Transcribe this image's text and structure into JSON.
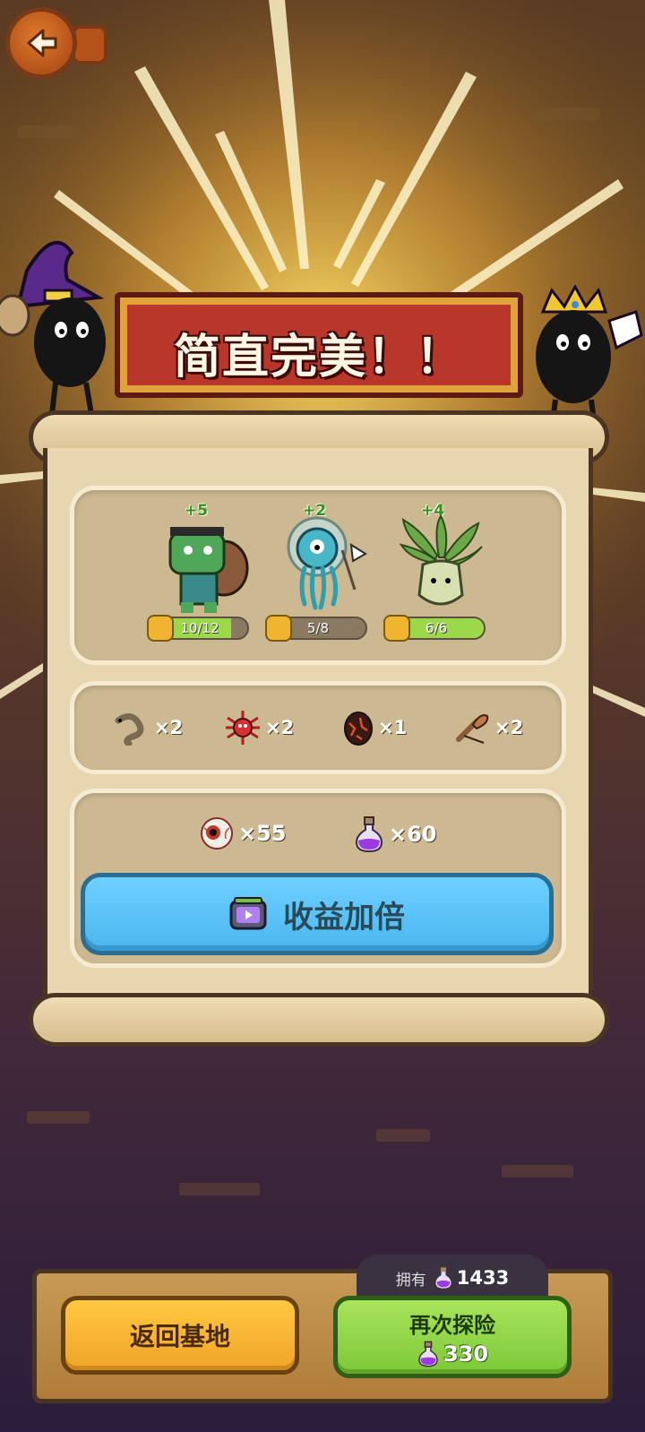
{
  "banner": {
    "title": "简直完美！！"
  },
  "monsters": [
    {
      "name": "frankenstein",
      "plus": "+5",
      "progress_text": "10/12",
      "progress": 0.83
    },
    {
      "name": "jellyfish-diver",
      "plus": "+2",
      "progress_text": "5/8",
      "progress": 0.0
    },
    {
      "name": "herb-plant",
      "plus": "+4",
      "progress_text": "6/6",
      "progress": 1.0
    }
  ],
  "materials": [
    {
      "icon": "worm-icon",
      "qty": "×2"
    },
    {
      "icon": "red-spider-icon",
      "qty": "×2"
    },
    {
      "icon": "lava-egg-icon",
      "qty": "×1"
    },
    {
      "icon": "slingshot-icon",
      "qty": "×2"
    }
  ],
  "rewards": [
    {
      "icon": "eyeball-icon",
      "qty": "×55"
    },
    {
      "icon": "purple-potion-icon",
      "qty": "×60"
    }
  ],
  "double_button": {
    "label": "收益加倍",
    "icon": "tv-video-icon"
  },
  "wallet": {
    "label": "拥有",
    "value": "1433",
    "icon": "purple-potion-icon"
  },
  "buttons": {
    "home": "返回基地",
    "again": "再次探险",
    "again_cost": "330"
  },
  "colors": {
    "banner": "#b8362a",
    "double_button": "#5ec4f6",
    "home_button": "#f8b838",
    "again_button": "#94d84a",
    "progress_fill": "#9bd94a"
  }
}
